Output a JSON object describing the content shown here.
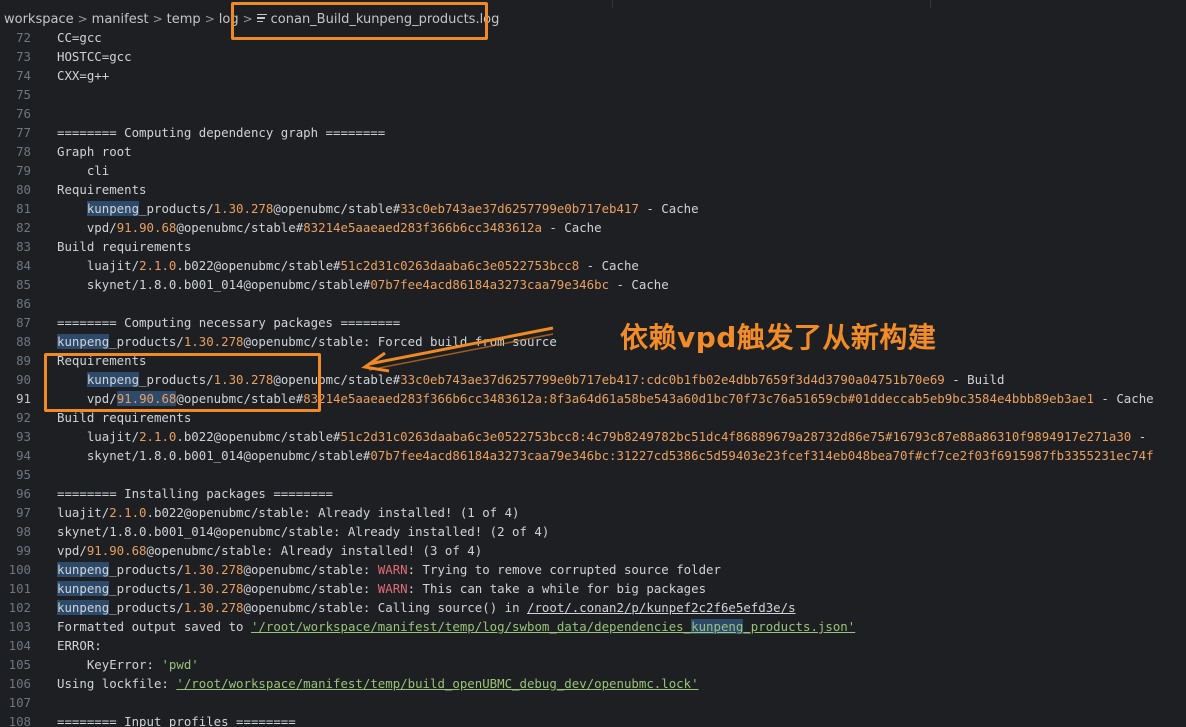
{
  "breadcrumb": {
    "items": [
      "workspace",
      "manifest",
      "temp",
      "log"
    ],
    "separator": ">",
    "file": "conan_Build_kunpeng_products.log",
    "file_icon": "lines-file-icon"
  },
  "annotation": {
    "text": "依赖vpd触发了从新构建",
    "color": "#f08a24"
  },
  "active_line": 91,
  "lines": [
    {
      "n": "72",
      "parts": [
        {
          "t": "CC=gcc"
        }
      ]
    },
    {
      "n": "73",
      "parts": [
        {
          "t": "HOSTCC=gcc"
        }
      ]
    },
    {
      "n": "74",
      "parts": [
        {
          "t": "CXX=g++"
        }
      ]
    },
    {
      "n": "75",
      "parts": []
    },
    {
      "n": "76",
      "parts": []
    },
    {
      "n": "77",
      "parts": [
        {
          "t": "======== Computing dependency graph ========"
        }
      ]
    },
    {
      "n": "78",
      "parts": [
        {
          "t": "Graph root"
        }
      ]
    },
    {
      "n": "79",
      "parts": [
        {
          "t": "    cli"
        }
      ]
    },
    {
      "n": "80",
      "parts": [
        {
          "t": "Requirements"
        }
      ]
    },
    {
      "n": "81",
      "parts": [
        {
          "t": "    "
        },
        {
          "t": "kunpeng",
          "c": "hl"
        },
        {
          "t": "_products/"
        },
        {
          "t": "1.30.278",
          "c": "c-ver"
        },
        {
          "t": "@openubmc/stable#"
        },
        {
          "t": "33c0eb743ae37d6257799e0b717eb417",
          "c": "c-hash"
        },
        {
          "t": " - Cache"
        }
      ]
    },
    {
      "n": "82",
      "parts": [
        {
          "t": "    vpd/"
        },
        {
          "t": "91.90.68",
          "c": "c-ver"
        },
        {
          "t": "@openubmc/stable#"
        },
        {
          "t": "83214e5aaeaed283f366b6cc3483612a",
          "c": "c-hash"
        },
        {
          "t": " - Cache"
        }
      ]
    },
    {
      "n": "83",
      "parts": [
        {
          "t": "Build requirements"
        }
      ]
    },
    {
      "n": "84",
      "parts": [
        {
          "t": "    luajit/"
        },
        {
          "t": "2.1.0",
          "c": "c-ver"
        },
        {
          "t": ".b022@openubmc/stable#"
        },
        {
          "t": "51c2d31c0263daaba6c3e0522753bcc8",
          "c": "c-hash"
        },
        {
          "t": " - Cache"
        }
      ]
    },
    {
      "n": "85",
      "parts": [
        {
          "t": "    skynet/1.8.0.b001_014@openubmc/stable#"
        },
        {
          "t": "07b7fee4acd86184a3273caa79e346bc",
          "c": "c-hash"
        },
        {
          "t": " - Cache"
        }
      ]
    },
    {
      "n": "86",
      "parts": []
    },
    {
      "n": "87",
      "parts": [
        {
          "t": "======== Computing necessary packages ========"
        }
      ]
    },
    {
      "n": "88",
      "parts": [
        {
          "t": "kunpeng",
          "c": "hl"
        },
        {
          "t": "_products/"
        },
        {
          "t": "1.30.278",
          "c": "c-ver"
        },
        {
          "t": "@openubmc/stable: Forced build from source"
        }
      ]
    },
    {
      "n": "89",
      "parts": [
        {
          "t": "Requirements"
        }
      ]
    },
    {
      "n": "90",
      "parts": [
        {
          "t": "    "
        },
        {
          "t": "kunpeng",
          "c": "hl"
        },
        {
          "t": "_products/"
        },
        {
          "t": "1.30.278",
          "c": "c-ver"
        },
        {
          "t": "@openubmc/stable#"
        },
        {
          "t": "33c0eb743ae37d6257799e0b717eb417:cdc0b1fb02e4dbb7659f3d4d3790a04751b70e69",
          "c": "c-hash"
        },
        {
          "t": " - Build"
        }
      ]
    },
    {
      "n": "91",
      "parts": [
        {
          "t": "    vpd/"
        },
        {
          "t": "91.90.68",
          "c": "c-ver hl"
        },
        {
          "t": "@openubmc/stable#"
        },
        {
          "t": "83214e5aaeaed283f366b6cc3483612a:8f3a64d61a58be543a60d1bc70f73c76a51659cb#01ddeccab5eb9bc3584e4bbb89eb3ae1",
          "c": "c-hash"
        },
        {
          "t": " - Cache"
        }
      ]
    },
    {
      "n": "92",
      "parts": [
        {
          "t": "Build requirements"
        }
      ]
    },
    {
      "n": "93",
      "parts": [
        {
          "t": "    luajit/"
        },
        {
          "t": "2.1.0",
          "c": "c-ver"
        },
        {
          "t": ".b022@openubmc/stable#"
        },
        {
          "t": "51c2d31c0263daaba6c3e0522753bcc8:4c79b8249782bc51dc4f86889679a28732d86e75#16793c87e88a86310f9894917e271a30",
          "c": "c-hash"
        },
        {
          "t": " -"
        }
      ]
    },
    {
      "n": "94",
      "parts": [
        {
          "t": "    skynet/1.8.0.b001_014@openubmc/stable#"
        },
        {
          "t": "07b7fee4acd86184a3273caa79e346bc:31227cd5386c5d59403e23fcef314eb048bea70f#cf7ce2f03f6915987fb3355231ec74f",
          "c": "c-hash"
        }
      ]
    },
    {
      "n": "95",
      "parts": []
    },
    {
      "n": "96",
      "parts": [
        {
          "t": "======== Installing packages ========"
        }
      ]
    },
    {
      "n": "97",
      "parts": [
        {
          "t": "luajit/"
        },
        {
          "t": "2.1.0",
          "c": "c-ver"
        },
        {
          "t": ".b022@openubmc/stable: Already installed! (1 of 4)"
        }
      ]
    },
    {
      "n": "98",
      "parts": [
        {
          "t": "skynet/1.8.0.b001_014@openubmc/stable: Already installed! (2 of 4)"
        }
      ]
    },
    {
      "n": "99",
      "parts": [
        {
          "t": "vpd/"
        },
        {
          "t": "91.90.68",
          "c": "c-ver"
        },
        {
          "t": "@openubmc/stable: Already installed! (3 of 4)"
        }
      ]
    },
    {
      "n": "100",
      "parts": [
        {
          "t": "kunpeng",
          "c": "hl"
        },
        {
          "t": "_products/"
        },
        {
          "t": "1.30.278",
          "c": "c-ver"
        },
        {
          "t": "@openubmc/stable: "
        },
        {
          "t": "WARN",
          "c": "c-warn"
        },
        {
          "t": ": Trying to remove corrupted source folder"
        }
      ]
    },
    {
      "n": "101",
      "parts": [
        {
          "t": "kunpeng",
          "c": "hl"
        },
        {
          "t": "_products/"
        },
        {
          "t": "1.30.278",
          "c": "c-ver"
        },
        {
          "t": "@openubmc/stable: "
        },
        {
          "t": "WARN",
          "c": "c-warn"
        },
        {
          "t": ": This can take a while for big packages"
        }
      ]
    },
    {
      "n": "102",
      "parts": [
        {
          "t": "kunpeng",
          "c": "hl"
        },
        {
          "t": "_products/"
        },
        {
          "t": "1.30.278",
          "c": "c-ver"
        },
        {
          "t": "@openubmc/stable: Calling source() in "
        },
        {
          "t": "/root/.conan2/p/kunpef2c2f6e5efd3e/s",
          "c": "c-path"
        }
      ]
    },
    {
      "n": "103",
      "parts": [
        {
          "t": "Formatted output saved to "
        },
        {
          "t": "'/root/workspace/manifest/temp/log/swbom_data/dependencies_",
          "c": "c-str c-path"
        },
        {
          "t": "kunpeng",
          "c": "c-str c-path hl"
        },
        {
          "t": "_products.json'",
          "c": "c-str c-path"
        }
      ]
    },
    {
      "n": "104",
      "parts": [
        {
          "t": "ERROR:"
        }
      ]
    },
    {
      "n": "105",
      "parts": [
        {
          "t": "    KeyError: "
        },
        {
          "t": "'pwd'",
          "c": "c-str"
        }
      ]
    },
    {
      "n": "106",
      "parts": [
        {
          "t": "Using lockfile: "
        },
        {
          "t": "'/root/workspace/manifest/temp/build_openUBMC_debug_dev/openubmc.lock'",
          "c": "c-str c-path"
        }
      ]
    },
    {
      "n": "107",
      "parts": []
    },
    {
      "n": "108",
      "parts": [
        {
          "t": "======== Input profiles ========"
        }
      ]
    }
  ]
}
